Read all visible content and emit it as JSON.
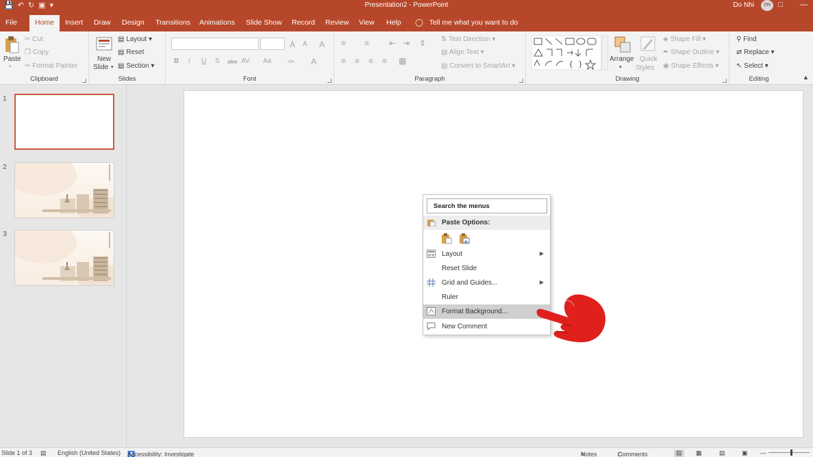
{
  "window": {
    "title": "Presentation2  -  PowerPoint",
    "user_name": "Do Nhi",
    "user_initials": "DN"
  },
  "tabs": [
    "File",
    "Home",
    "Insert",
    "Draw",
    "Design",
    "Transitions",
    "Animations",
    "Slide Show",
    "Record",
    "Review",
    "View",
    "Help"
  ],
  "active_tab": "Home",
  "tell_me": "Tell me what you want to do",
  "ribbon": {
    "clipboard": {
      "label": "Clipboard",
      "paste": "Paste",
      "cut": "Cut",
      "copy": "Copy",
      "format_painter": "Format Painter"
    },
    "slides": {
      "label": "Slides",
      "new_slide_1": "New",
      "new_slide_2": "Slide",
      "layout": "Layout",
      "reset": "Reset",
      "section": "Section"
    },
    "font": {
      "label": "Font",
      "bold": "B",
      "italic": "I",
      "underline": "U",
      "shadow": "S",
      "strike": "abc",
      "spacing": "AV",
      "case": "Aa",
      "grow": "A",
      "shrink": "A",
      "clear": "A",
      "color": "A"
    },
    "paragraph": {
      "label": "Paragraph",
      "text_direction": "Text Direction",
      "align_text": "Align Text",
      "convert_smartart": "Convert to SmartArt"
    },
    "drawing": {
      "label": "Drawing",
      "arrange": "Arrange",
      "quick_styles_1": "Quick",
      "quick_styles_2": "Styles",
      "shape_fill": "Shape Fill",
      "shape_outline": "Shape Outline",
      "shape_effects": "Shape Effects"
    },
    "editing": {
      "label": "Editing",
      "find": "Find",
      "replace": "Replace",
      "select": "Select"
    }
  },
  "slides_pane": [
    {
      "number": "1"
    },
    {
      "number": "2"
    },
    {
      "number": "3"
    }
  ],
  "context_menu": {
    "search_placeholder": "Search the menus",
    "paste_options": "Paste Options:",
    "items": [
      {
        "label": "Layout",
        "icon": "layout-icon",
        "submenu": true
      },
      {
        "label": "Reset Slide",
        "icon": "",
        "submenu": false
      },
      {
        "label": "Grid and Guides...",
        "icon": "grid-icon",
        "submenu": true
      },
      {
        "label": "Ruler",
        "icon": "",
        "submenu": false
      },
      {
        "label": "Format Background...",
        "icon": "format-background-icon",
        "submenu": false
      },
      {
        "label": "New Comment",
        "icon": "comment-icon",
        "submenu": false
      }
    ]
  },
  "status_bar": {
    "slide_count": "Slide 1 of 3",
    "language": "English (United States)",
    "accessibility": "Accessibility: Investigate",
    "notes": "Notes",
    "comments": "Comments"
  },
  "colors": {
    "accent": "#b7472a",
    "pointer_hand": "#e0201b"
  }
}
